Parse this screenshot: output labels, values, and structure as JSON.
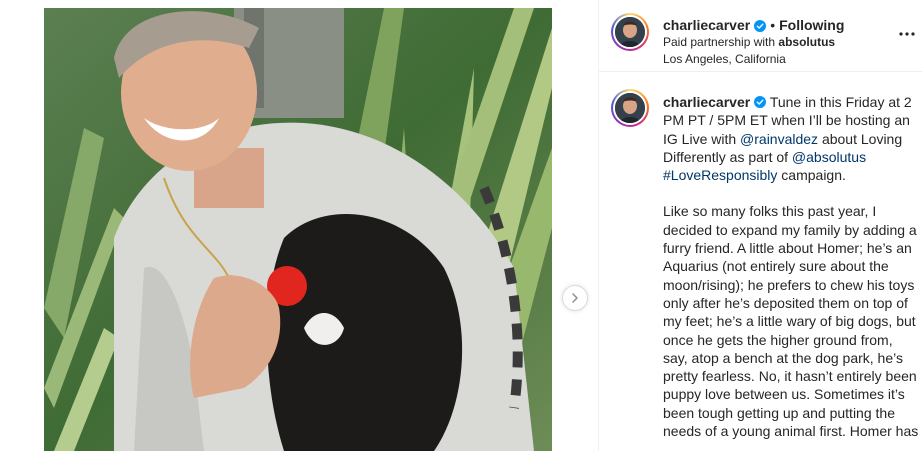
{
  "post": {
    "username": "charliecarver",
    "follow_separator": "•",
    "follow_status": "Following",
    "partnership_prefix": "Paid partnership with",
    "partner": "absolutus",
    "location": "Los Angeles, California"
  },
  "caption": {
    "username": "charliecarver",
    "intro_1": "Tune in this Friday at 2 PM PT / 5PM ET when I’ll be hosting an IG Live with",
    "mention_1": "@rainvaldez",
    "intro_2": "about Loving Differently as part of",
    "mention_2": "@absolutus",
    "hashtag": "#LoveResponsibly",
    "intro_3": "campaign.",
    "paragraph_2": "Like so many folks this past year, I decided to expand my family by adding a furry friend. A little about Homer; he’s an Aquarius (not entirely sure about the moon/rising); he prefers to chew his toys only after he’s deposited them on top of my feet; he’s a little wary of big dogs, but once he gets the higher ground from, say, atop a bench at the dog park, he’s pretty fearless. No, it hasn’t entirely been puppy love between us. Sometimes it’s been tough getting up and putting the needs of a young animal first. Homer has"
  },
  "icons": {
    "verified": "verified-badge-icon",
    "more": "more-options-icon",
    "next": "chevron-right-icon"
  },
  "colors": {
    "link": "#00376b",
    "verified": "#0095f6",
    "text": "#262626",
    "border": "#efefef"
  }
}
